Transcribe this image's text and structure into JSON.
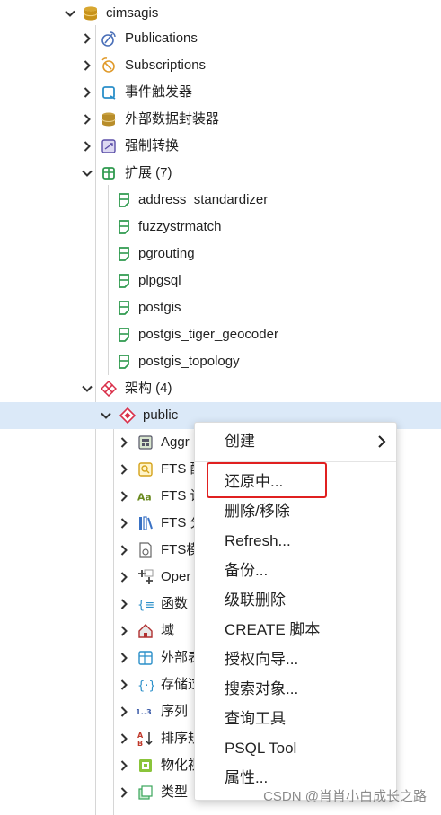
{
  "tree": {
    "root": {
      "label": "cimsagis"
    },
    "publications": {
      "label": "Publications"
    },
    "subscriptions": {
      "label": "Subscriptions"
    },
    "triggers": {
      "label": "事件触发器"
    },
    "fdw": {
      "label": "外部数据封装器"
    },
    "casts": {
      "label": "强制转换"
    },
    "extensions": {
      "label": "扩展 (7)"
    },
    "ext_items": [
      {
        "label": "address_standardizer"
      },
      {
        "label": "fuzzystrmatch"
      },
      {
        "label": "pgrouting"
      },
      {
        "label": "plpgsql"
      },
      {
        "label": "postgis"
      },
      {
        "label": "postgis_tiger_geocoder"
      },
      {
        "label": "postgis_topology"
      }
    ],
    "schemas": {
      "label": "架构 (4)"
    },
    "public": {
      "label": "public"
    },
    "public_items": [
      {
        "label": "Aggr"
      },
      {
        "label": "FTS 配"
      },
      {
        "label": "FTS 词"
      },
      {
        "label": "FTS 分"
      },
      {
        "label": "FTS模"
      },
      {
        "label": "Oper"
      },
      {
        "label": "函数"
      },
      {
        "label": "域"
      },
      {
        "label": "外部表"
      },
      {
        "label": "存储过"
      },
      {
        "label": "序列"
      },
      {
        "label": "排序规"
      },
      {
        "label": "物化视"
      },
      {
        "label": "类型"
      }
    ]
  },
  "context_menu": {
    "create": "创建",
    "restore": "还原中...",
    "delete": "删除/移除",
    "refresh": "Refresh...",
    "backup": "备份...",
    "cascade_delete": "级联删除",
    "create_script": "CREATE 脚本",
    "grant_wizard": "授权向导...",
    "search_objects": "搜索对象...",
    "query_tool": "查询工具",
    "psql_tool": "PSQL Tool",
    "properties": "属性..."
  },
  "watermark": "CSDN @肖肖小白成长之路",
  "colors": {
    "selected_row": "#dbe9f8",
    "highlight_box": "#e02020",
    "extension_icon": "#2f9a4f",
    "schema_icon": "#d9304a"
  }
}
